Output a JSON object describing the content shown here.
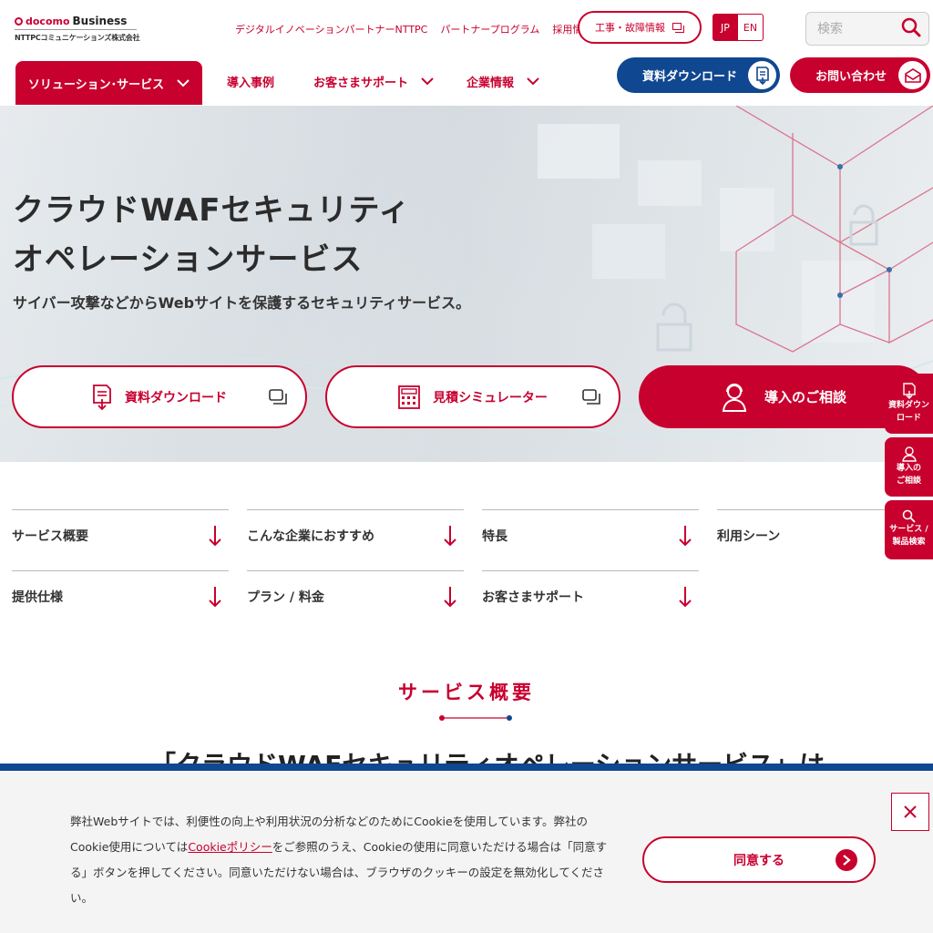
{
  "colors": {
    "brand_red": "#c8002e",
    "brand_blue": "#0f4791"
  },
  "logo": {
    "top_brand": "docomo",
    "top_rest": "Business",
    "bottom": "NTTPCコミュニケーションズ株式会社"
  },
  "util_links": [
    "デジタルイノベーションパートナーNTTPC",
    "パートナープログラム",
    "採用情報"
  ],
  "trouble_btn": "工事・故障情報",
  "lang": {
    "jp": "JP",
    "en": "EN"
  },
  "search": {
    "placeholder": "検索",
    "icon": "search-icon"
  },
  "nav": {
    "active": "ソリューション･サービス",
    "items": [
      "導入事例",
      "お客さまサポート",
      "企業情報"
    ],
    "download_btn": "資料ダウンロード",
    "contact_btn": "お問い合わせ"
  },
  "hero": {
    "title_line1": "クラウドWAFセキュリティ",
    "title_line2": "オペレーションサービス",
    "subtitle": "サイバー攻撃などからWebサイトを保護するセキュリティサービス。",
    "btn_download": "資料ダウンロード",
    "btn_simulator": "見積シミュレーター",
    "btn_consult": "導入のご相談"
  },
  "side": {
    "download": [
      "資料ダウン",
      "ロード"
    ],
    "consult": [
      "導入の",
      "ご相談"
    ],
    "search": [
      "サービス /",
      "製品検索"
    ]
  },
  "anchors": [
    "サービス概要",
    "こんな企業におすすめ",
    "特長",
    "利用シーン",
    "提供仕様",
    "プラン / 料金",
    "お客さまサポート"
  ],
  "section": {
    "title": "サービス概要",
    "intro": "「クラウドWAFセキュリティオペレーションサービス」は"
  },
  "cookie": {
    "text_before": "弊社Webサイトでは、利便性の向上や利用状況の分析などのためにCookieを使用しています。弊社のCookie使用については",
    "link": "Cookieポリシー",
    "text_after": "をご参照のうえ、Cookieの使用に同意いただける場合は「同意する」ボタンを押してください。同意いただけない場合は、ブラウザのクッキーの設定を無効化してください。",
    "agree": "同意する"
  }
}
